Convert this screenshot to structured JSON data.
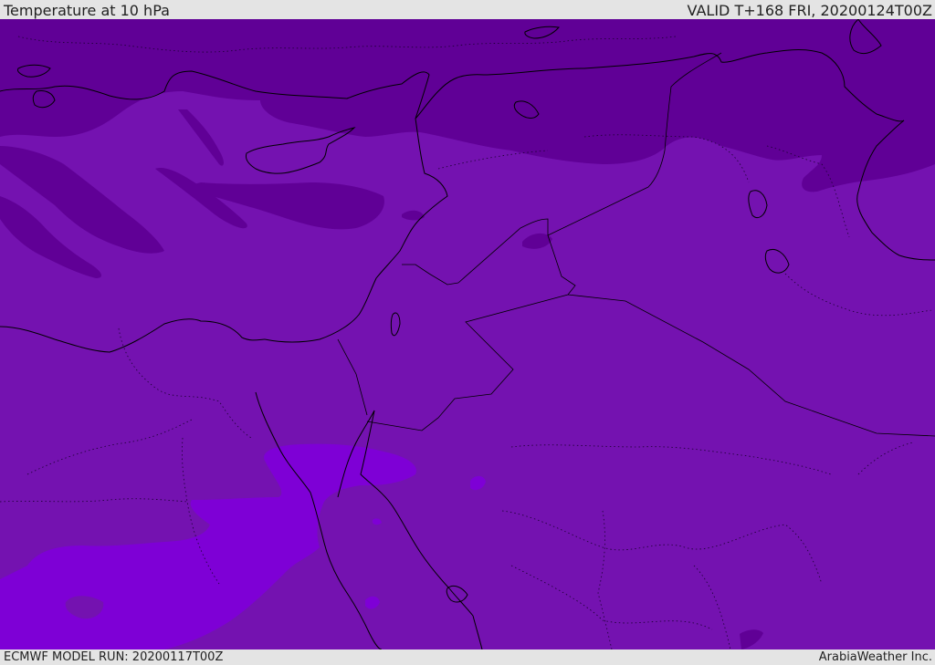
{
  "header": {
    "title": "Temperature at 10 hPa",
    "valid_time": "VALID T+168 FRI, 20200124T00Z"
  },
  "footer": {
    "model_run": "ECMWF MODEL RUN: 20200117T00Z",
    "credit": "ArabiaWeather Inc."
  },
  "map": {
    "field": "temperature",
    "level": "10 hPa",
    "colors": {
      "cold_band": "#600096",
      "mid_band": "#7412b0",
      "warm_band": "#7e00d6",
      "coastline": "#000000"
    }
  }
}
